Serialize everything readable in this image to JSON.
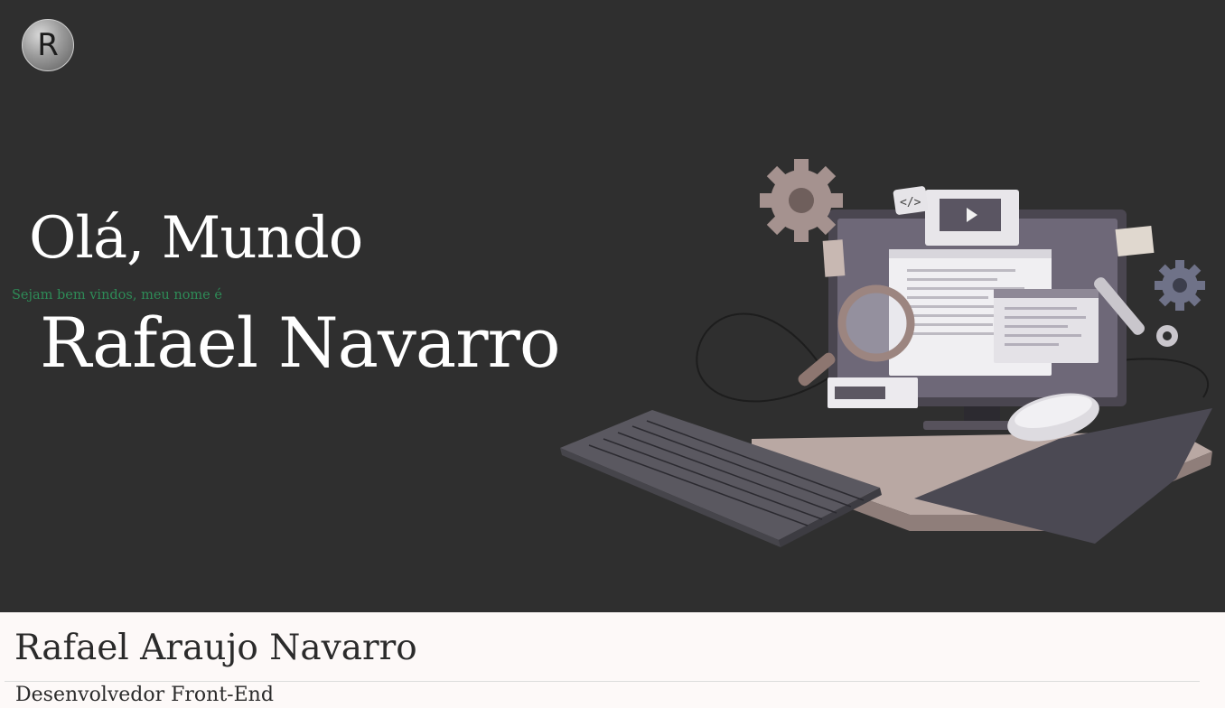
{
  "header": {
    "logo_letter": "R"
  },
  "hero": {
    "greeting": "Olá, Mundo",
    "welcome": "Sejam bem vindos, meu nome é",
    "name": "Rafael Navarro",
    "colors": {
      "background": "#2f2f2f",
      "text": "#ffffff",
      "accent": "#2e8b57"
    },
    "illustration": {
      "icons": [
        "gear-icon",
        "code-icon",
        "play-icon",
        "magnifier-icon",
        "wrench-icon",
        "monitor-icon",
        "keyboard-icon",
        "mouse-icon"
      ]
    }
  },
  "profile": {
    "full_name": "Rafael Araujo Navarro",
    "role": "Desenvolvedor Front-End"
  }
}
